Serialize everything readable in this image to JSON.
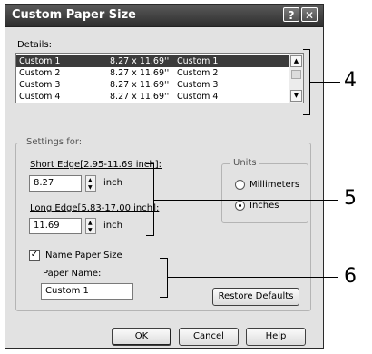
{
  "window": {
    "title": "Custom Paper Size",
    "help_glyph": "?",
    "close_glyph": "✕"
  },
  "details": {
    "label": "Details:",
    "rows": [
      {
        "name": "Custom 1",
        "size": "8.27 x 11.69''",
        "desc": "Custom 1"
      },
      {
        "name": "Custom 2",
        "size": "8.27 x 11.69''",
        "desc": "Custom 2"
      },
      {
        "name": "Custom 3",
        "size": "8.27 x 11.69''",
        "desc": "Custom 3"
      },
      {
        "name": "Custom 4",
        "size": "8.27 x 11.69''",
        "desc": "Custom 4"
      }
    ]
  },
  "settings": {
    "group_label": "Settings for:",
    "short_edge": {
      "label": "Short Edge[2.95-11.69 inch]:",
      "value": "8.27",
      "unit": "inch"
    },
    "long_edge": {
      "label": "Long Edge[5.83-17.00 inch]:",
      "value": "11.69",
      "unit": "inch"
    },
    "units": {
      "label": "Units",
      "options": [
        {
          "label": "Millimeters",
          "selected": false
        },
        {
          "label": "Inches",
          "selected": true
        }
      ]
    },
    "name_paper_size": {
      "label": "Name Paper Size",
      "checked": true
    },
    "paper_name": {
      "label": "Paper Name:",
      "value": "Custom 1"
    },
    "restore_label": "Restore Defaults"
  },
  "buttons": {
    "ok": "OK",
    "cancel": "Cancel",
    "help": "Help"
  },
  "callouts": [
    "4",
    "5",
    "6"
  ]
}
